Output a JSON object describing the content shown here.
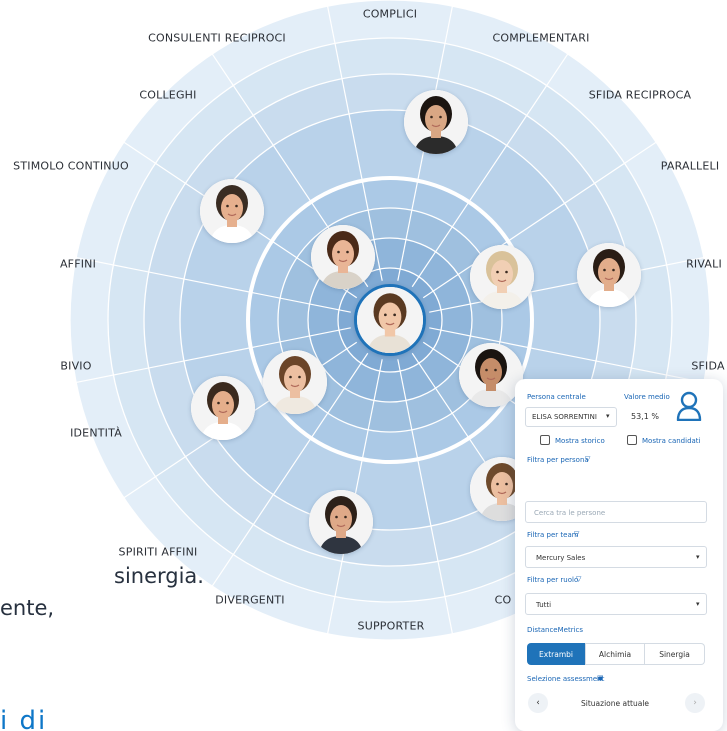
{
  "categories": [
    "COMPLICI",
    "COMPLEMENTARI",
    "SFIDA RECIPROCA",
    "PARALLELI",
    "RIVALI",
    "SFIDA",
    "CO",
    "SUPPORTER",
    "DIVERGENTI",
    "SPIRITI AFFINI",
    "IDENTITÀ",
    "BIVIO",
    "AFFINI",
    "STIMOLO CONTINUO",
    "COLLEGHI",
    "CONSULENTI RECIPROCI"
  ],
  "background_text": {
    "line1": "sinergia.",
    "line2": "ente,",
    "line3": "i di"
  },
  "people": [
    {
      "name": "center",
      "hair": "#5a3a22",
      "skin": "#f1c7a8",
      "shirt": "#e8e1d6"
    },
    {
      "name": "top",
      "hair": "#1c1510",
      "skin": "#d9a784",
      "shirt": "#2b2b2b"
    },
    {
      "name": "upper-left",
      "hair": "#3a2c22",
      "skin": "#e6b08e",
      "shirt": "#ffffff"
    },
    {
      "name": "inner-upper-left",
      "hair": "#4a2a18",
      "skin": "#e9b596",
      "shirt": "#d9d2c8"
    },
    {
      "name": "inner-upper-right",
      "hair": "#d9c29a",
      "skin": "#f1cfb4",
      "shirt": "#f3f0ea"
    },
    {
      "name": "right",
      "hair": "#2a1d15",
      "skin": "#e2ad8b",
      "shirt": "#ffffff"
    },
    {
      "name": "inner-right",
      "hair": "#1a1410",
      "skin": "#c58d69",
      "shirt": "#e9e9e9"
    },
    {
      "name": "inner-left",
      "hair": "#6b4529",
      "skin": "#ecbfa1",
      "shirt": "#efe9e0"
    },
    {
      "name": "left",
      "hair": "#3b2a1e",
      "skin": "#e5ae8b",
      "shirt": "#ffffff"
    },
    {
      "name": "bottom",
      "hair": "#2d2119",
      "skin": "#dfa988",
      "shirt": "#2f3540"
    },
    {
      "name": "bottom-right",
      "hair": "#6e4a2c",
      "skin": "#ecbfa0",
      "shirt": "#ddd"
    }
  ],
  "panel": {
    "persona_label": "Persona centrale",
    "persona_value": "ELISA SORRENTINI",
    "valore_label": "Valore medio",
    "valore_value": "53,1 %",
    "mostra_storico": "Mostra storico",
    "mostra_candidati": "Mostra candidati",
    "filtra_persona": "Filtra per persona",
    "cerca_placeholder": "Cerca tra le persone",
    "filtra_team": "Filtra per team",
    "team_value": "Mercury Sales",
    "filtra_ruolo": "Filtra per ruolo",
    "ruolo_value": "Tutti",
    "distance_label": "DistanceMetrics",
    "tabs": [
      "Extrambi",
      "Alchimia",
      "Sinergia"
    ],
    "selezione_label": "Selezione assessment",
    "situazione": "Situazione attuale"
  },
  "colors": {
    "accent": "#1f73b9",
    "ring_outer": "#e3eef8",
    "ring_mid": "#c9dcee",
    "ring_inner": "#9fc0df",
    "ring_core": "#80aad4"
  }
}
